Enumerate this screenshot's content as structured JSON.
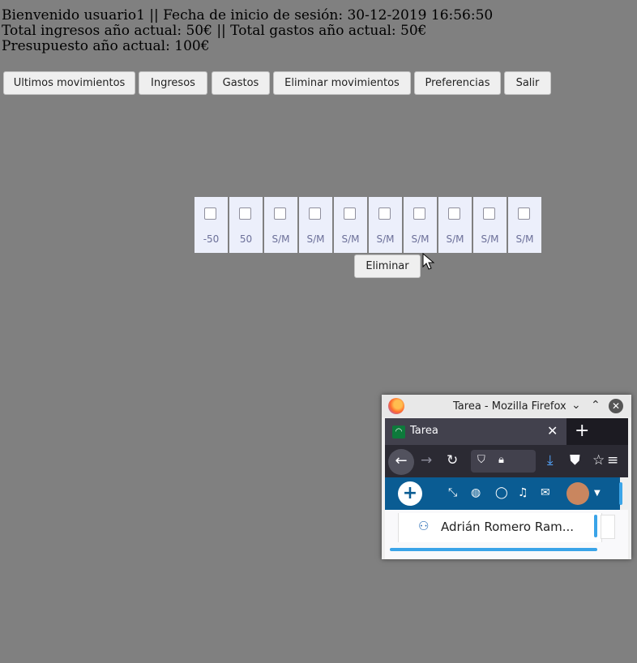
{
  "header": {
    "line1": "Bienvenido usuario1 || Fecha de inicio de sesión: 30-12-2019 16:56:50",
    "line2": "Total ingresos año actual: 50€ || Total gastos año actual: 50€",
    "line3": "Presupuesto año actual: 100€"
  },
  "menu": [
    {
      "label": "Ultimos movimientos"
    },
    {
      "label": "Ingresos"
    },
    {
      "label": "Gastos"
    },
    {
      "label": "Eliminar movimientos"
    },
    {
      "label": "Preferencias"
    },
    {
      "label": "Salir"
    }
  ],
  "movements": [
    {
      "value": "-50",
      "checked": false
    },
    {
      "value": "50",
      "checked": false
    },
    {
      "value": "S/M",
      "checked": false
    },
    {
      "value": "S/M",
      "checked": false
    },
    {
      "value": "S/M",
      "checked": false
    },
    {
      "value": "S/M",
      "checked": false
    },
    {
      "value": "S/M",
      "checked": false
    },
    {
      "value": "S/M",
      "checked": false
    },
    {
      "value": "S/M",
      "checked": false
    },
    {
      "value": "S/M",
      "checked": false
    }
  ],
  "delete_button_label": "Eliminar",
  "firefox": {
    "window_title": "Tarea - Mozilla Firefox",
    "tab_label": "Tarea",
    "user_name": "Adrián Romero Ram..."
  },
  "colors": {
    "background": "#808080",
    "cell_background": "#eceffb",
    "site_header": "#0a5c93",
    "accent_scroll": "#3aa4e8"
  }
}
